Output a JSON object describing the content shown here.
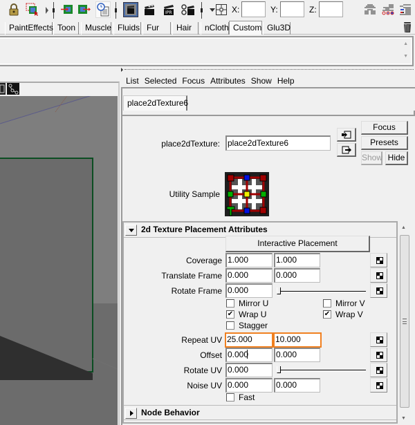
{
  "toolbar": {
    "icons": [
      "lock-icon",
      "select-marquee-icon",
      "input-connection-icon",
      "output-connection-icon",
      "history-icon",
      "render-view-icon",
      "render-clapper-icon",
      "ipr-render-icon",
      "render-settings-icon",
      "snap-target-icon",
      "channel-box-icon",
      "attribute-editor-icon",
      "tool-settings-icon"
    ],
    "x_label": "X:",
    "y_label": "Y:",
    "z_label": "Z:",
    "x_value": "",
    "y_value": "",
    "z_value": ""
  },
  "shelf": {
    "tabs": [
      "PaintEffects",
      "Toon",
      "Muscle",
      "Fluids",
      "Fur",
      "Hair",
      "nCloth",
      "Custom",
      "Glu3D"
    ],
    "active_tab": "Custom"
  },
  "attribute_editor": {
    "menu": [
      "List",
      "Selected",
      "Focus",
      "Attributes",
      "Show",
      "Help"
    ],
    "node_tab": "place2dTexture6",
    "node_type_label": "place2dTexture:",
    "node_name": "place2dTexture6",
    "buttons": {
      "focus": "Focus",
      "presets": "Presets",
      "show": "Show",
      "hide": "Hide"
    },
    "sample_label": "Utility Sample",
    "sections": {
      "placement": {
        "title": "2d Texture Placement Attributes",
        "expanded": true,
        "interactive_placement": "Interactive Placement",
        "rows": {
          "coverage": {
            "label": "Coverage",
            "u": "1.000",
            "v": "1.000"
          },
          "translate_frame": {
            "label": "Translate Frame",
            "u": "0.000",
            "v": "0.000"
          },
          "rotate_frame": {
            "label": "Rotate Frame",
            "value": "0.000",
            "slider": 0
          },
          "repeat_uv": {
            "label": "Repeat UV",
            "u": "25.000",
            "v": "10.000"
          },
          "offset": {
            "label": "Offset",
            "u": "0.000",
            "v": "0.000"
          },
          "rotate_uv": {
            "label": "Rotate UV",
            "value": "0.000",
            "slider": 0
          },
          "noise_uv": {
            "label": "Noise UV",
            "u": "0.000",
            "v": "0.000"
          }
        },
        "checkboxes": {
          "mirror_u": {
            "label": "Mirror U",
            "checked": false
          },
          "mirror_v": {
            "label": "Mirror V",
            "checked": false
          },
          "wrap_u": {
            "label": "Wrap U",
            "checked": true
          },
          "wrap_v": {
            "label": "Wrap V",
            "checked": true
          },
          "stagger": {
            "label": "Stagger",
            "checked": false
          },
          "fast": {
            "label": "Fast",
            "checked": false
          }
        }
      },
      "node_behavior": {
        "title": "Node Behavior",
        "expanded": false
      }
    },
    "highlight_color": "#f08020"
  },
  "viewport": {
    "object_outline_color": "#0b4d22"
  }
}
